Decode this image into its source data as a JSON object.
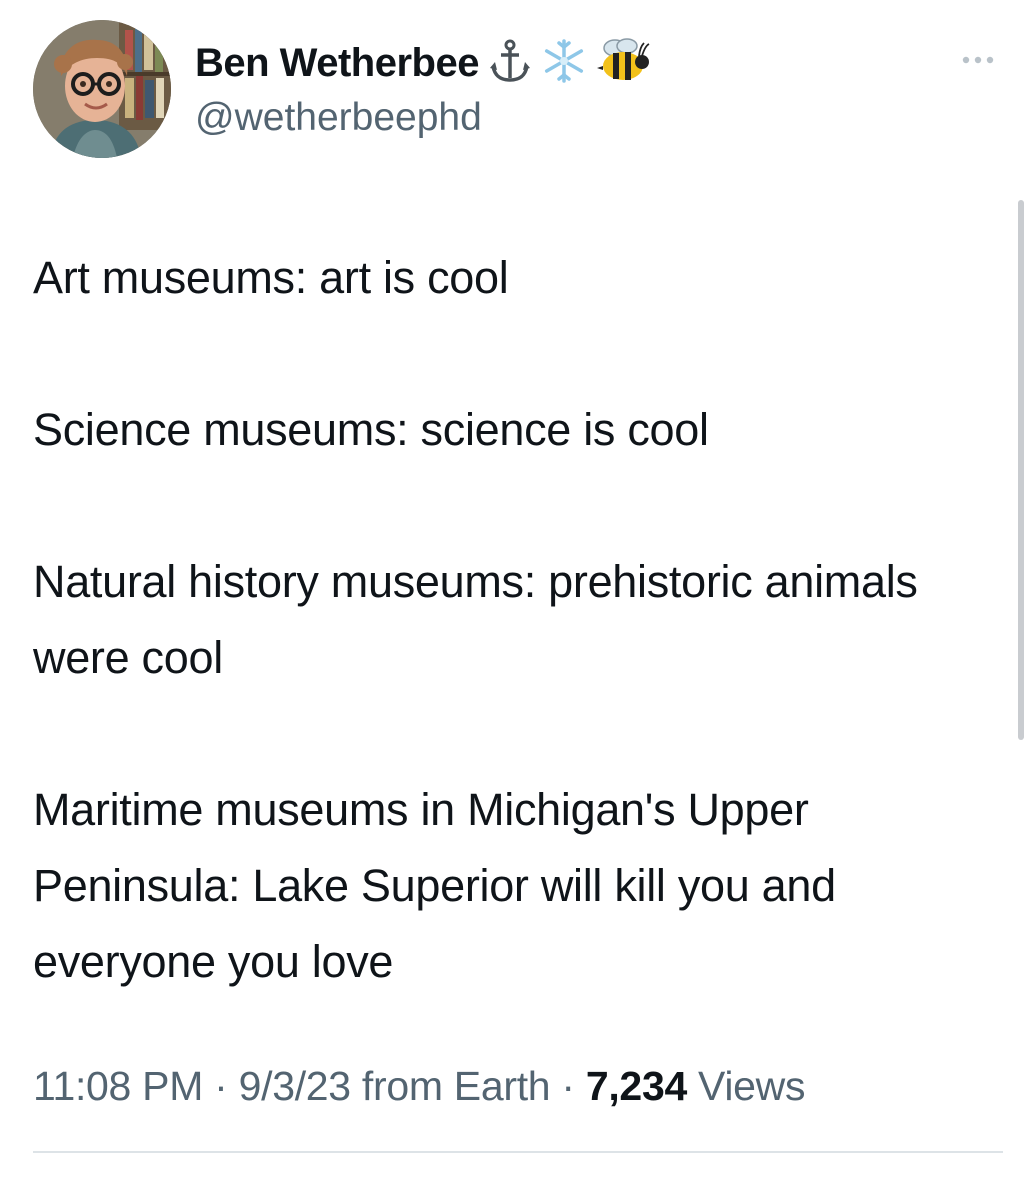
{
  "author": {
    "display_name": "Ben Wetherbee",
    "name_emojis": [
      "⚓",
      "❄️",
      "🐝"
    ],
    "handle": "@wetherbeephd"
  },
  "tweet": {
    "paragraphs": [
      "Art museums: art is cool",
      "Science museums: science is cool",
      "Natural history museums: prehistoric animals were cool",
      "Maritime museums in Michigan's Upper Peninsula: Lake Superior will kill you and everyone you love"
    ]
  },
  "meta": {
    "time": "11:08 PM",
    "separator": "·",
    "date": "9/3/23",
    "source": "from Earth",
    "views_count": "7,234",
    "views_label": "Views"
  },
  "icons": {
    "more": "more-horizontal-icon",
    "anchor": "anchor-emoji",
    "snowflake": "snowflake-emoji",
    "bee": "bee-emoji"
  },
  "colors": {
    "text_primary": "#0f1419",
    "text_secondary": "#536471",
    "divider": "#dde3e7"
  }
}
